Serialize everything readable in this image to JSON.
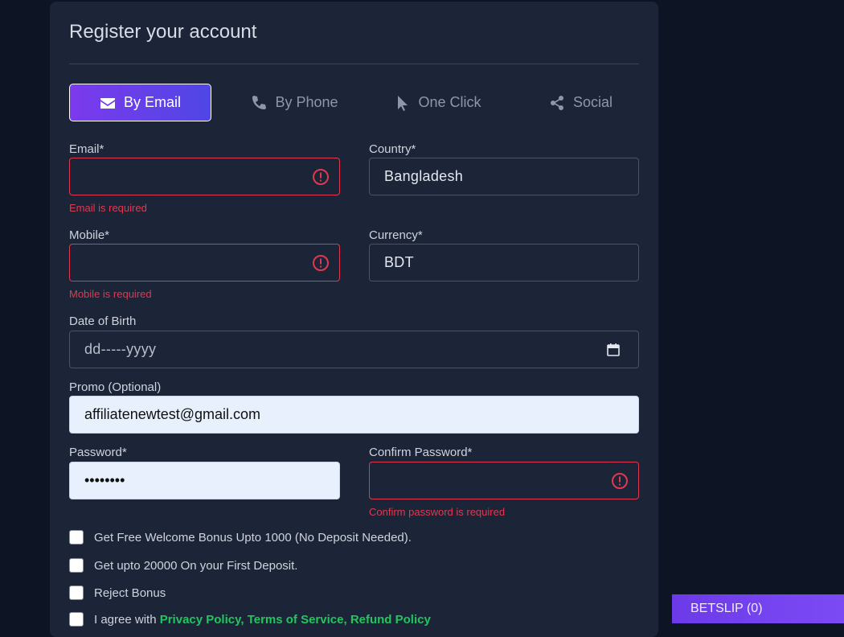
{
  "title": "Register your account",
  "tabs": [
    {
      "label": "By Email",
      "icon": "envelope-icon",
      "active": true
    },
    {
      "label": "By Phone",
      "icon": "phone-icon",
      "active": false
    },
    {
      "label": "One Click",
      "icon": "cursor-icon",
      "active": false
    },
    {
      "label": "Social",
      "icon": "share-icon",
      "active": false
    }
  ],
  "form": {
    "email": {
      "label": "Email*",
      "value": "",
      "error": "Email is required"
    },
    "country": {
      "label": "Country*",
      "value": "Bangladesh"
    },
    "mobile": {
      "label": "Mobile*",
      "value": "",
      "error": "Mobile is required"
    },
    "currency": {
      "label": "Currency*",
      "value": "BDT"
    },
    "dob": {
      "label": "Date of Birth",
      "placeholder": "dd-----yyyy"
    },
    "promo": {
      "label": "Promo (Optional)",
      "value": "affiliatenewtest@gmail.com"
    },
    "password": {
      "label": "Password*",
      "value": "••••••••"
    },
    "confirm_password": {
      "label": "Confirm Password*",
      "value": "",
      "error": "Confirm password is required"
    }
  },
  "checkboxes": [
    {
      "label": "Get Free Welcome Bonus Upto 1000 (No Deposit Needed)."
    },
    {
      "label": "Get upto 20000 On your First Deposit."
    },
    {
      "label": "Reject Bonus"
    }
  ],
  "agree": {
    "prefix": "I agree with",
    "privacy": "Privacy Policy,",
    "terms": "Terms of Service,",
    "refund": "Refund Policy"
  },
  "betslip": "BETSLIP (0)",
  "colors": {
    "accent": "#7c3aed",
    "error": "#e0394f",
    "link": "#22c55e"
  }
}
